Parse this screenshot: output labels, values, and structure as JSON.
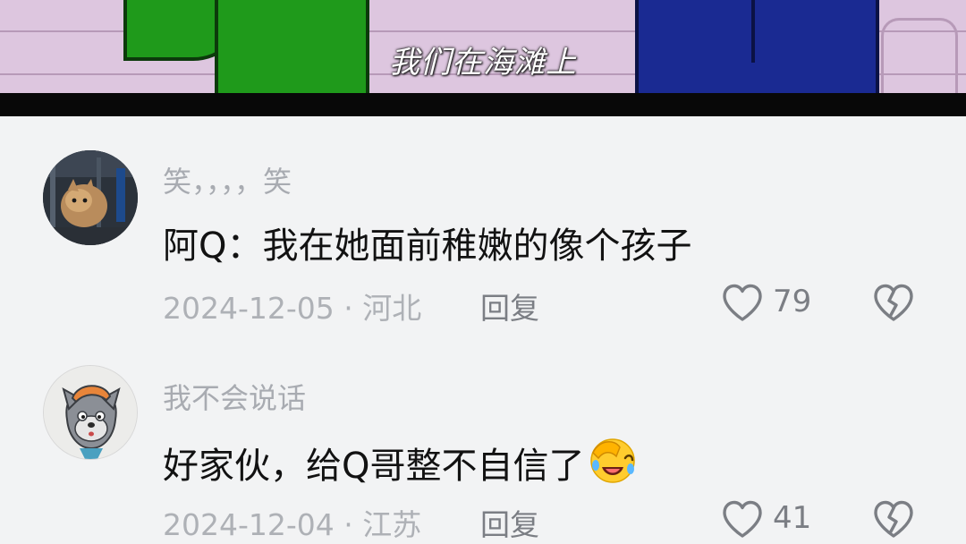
{
  "video": {
    "subtitle": "我们在海滩上"
  },
  "comments": [
    {
      "username": "笑，，，，笑",
      "text": "阿Q：我在她面前稚嫩的像个孩子",
      "date_location": "2024-12-05 · 河北",
      "reply_label": "回复",
      "likes": "79",
      "avatar_icon": "cat-photo-avatar"
    },
    {
      "username": "我不会说话",
      "text": "好家伙，给Q哥整不自信了",
      "emoji_icon": "facepalm-laughing-emoji-icon",
      "date_location": "2024-12-04 · 江苏",
      "reply_label": "回复",
      "likes": "41",
      "avatar_icon": "grey-wolf-cartoon-avatar"
    }
  ],
  "colors": {
    "background": "#f2f3f4",
    "username": "#a8abb1",
    "text": "#121212",
    "meta": "#aeb1b6"
  }
}
